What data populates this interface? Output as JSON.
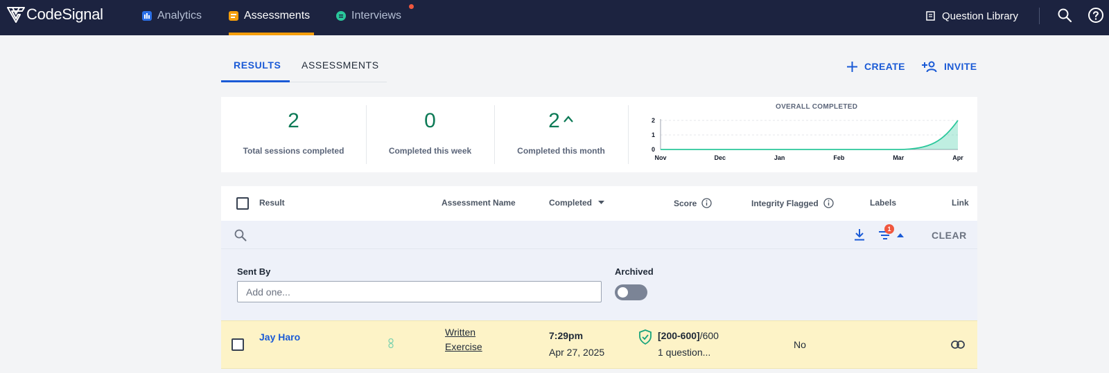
{
  "nav": {
    "brand": "CodeSignal",
    "links": [
      {
        "label": "Analytics",
        "icon": "bar-chart-icon"
      },
      {
        "label": "Assessments",
        "icon": "clipboard-icon"
      },
      {
        "label": "Interviews",
        "icon": "chat-icon"
      }
    ],
    "question_library": "Question Library",
    "accent_color": "#f59e0b"
  },
  "tabs": [
    {
      "label": "RESULTS"
    },
    {
      "label": "ASSESSMENTS"
    }
  ],
  "actions": {
    "create": "CREATE",
    "invite": "INVITE"
  },
  "stats": [
    {
      "value": "2",
      "label": "Total sessions completed"
    },
    {
      "value": "0",
      "label": "Completed this week"
    },
    {
      "value": "2",
      "label": "Completed this month"
    }
  ],
  "chart_data": {
    "type": "area",
    "title": "OVERALL COMPLETED",
    "x": [
      "Nov",
      "Dec",
      "Jan",
      "Feb",
      "Mar",
      "Apr"
    ],
    "yticks": [
      "0",
      "1",
      "2"
    ],
    "ylim": [
      0,
      2
    ],
    "series": [
      {
        "values": [
          0,
          0,
          0,
          0,
          0,
          2
        ]
      }
    ],
    "color": "#2ac79b"
  },
  "table": {
    "columns": [
      "Result",
      "Assessment Name",
      "Completed",
      "Score",
      "Integrity Flagged",
      "Labels",
      "Link"
    ],
    "clear": "CLEAR",
    "filter_count": "1",
    "rows": [
      {
        "name": "Jay Haro",
        "assessment_line1": "Written",
        "assessment_line2": "Exercise",
        "time": "7:29pm",
        "date": "Apr 27, 2025",
        "score_range": "[200-600]",
        "score_total": "/600",
        "score_sub": "1 question...",
        "flagged": "No"
      }
    ]
  },
  "filters": {
    "sent_by_label": "Sent By",
    "sent_by_placeholder": "Add one...",
    "archived_label": "Archived"
  }
}
